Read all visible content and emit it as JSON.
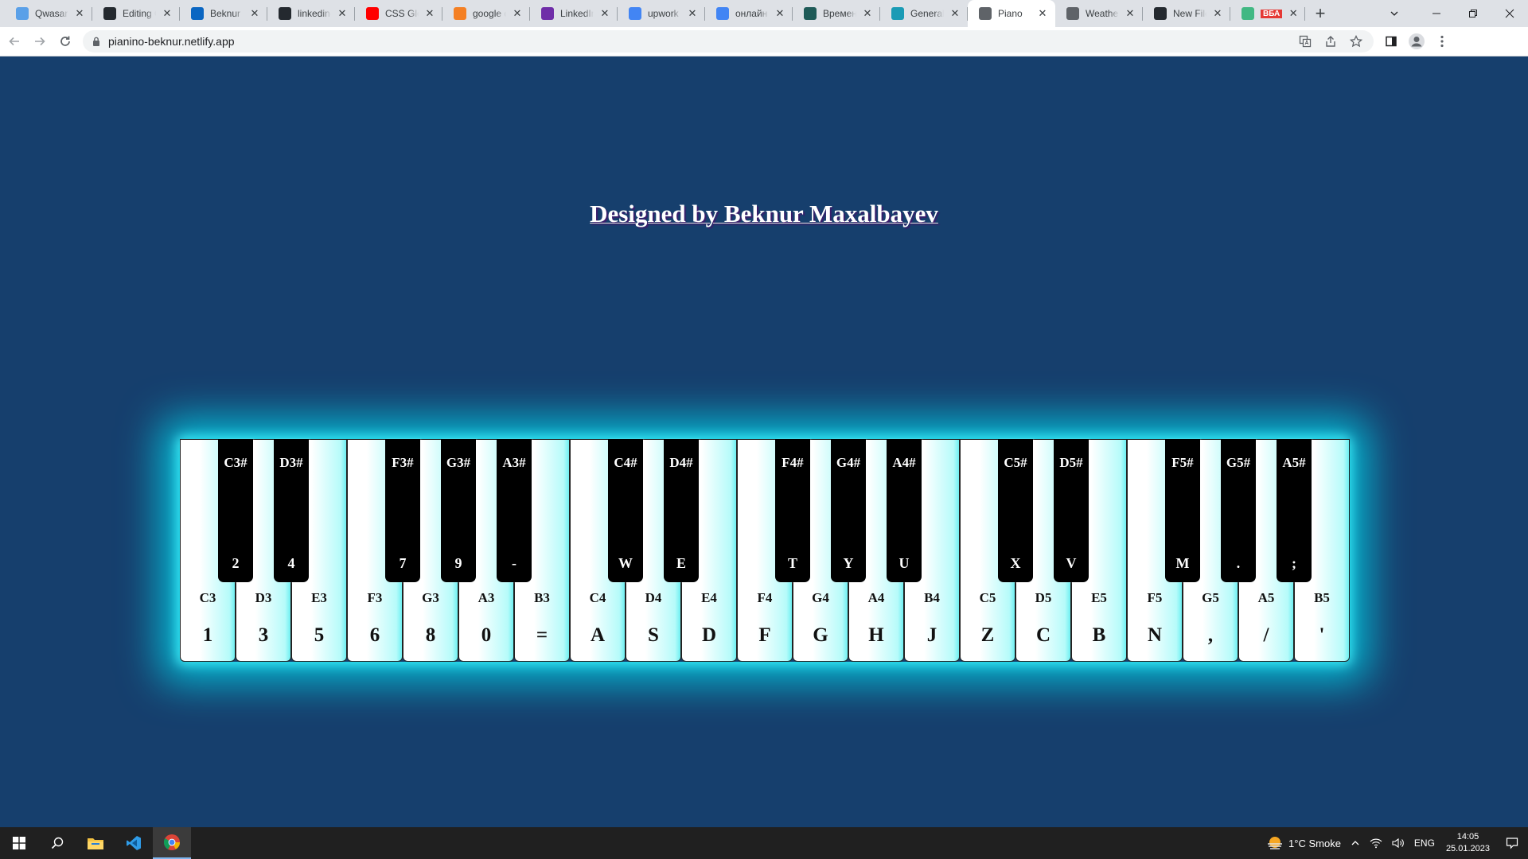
{
  "browser": {
    "tabs": [
      {
        "title": "Qwasar.",
        "favicon": "qwasar-icon",
        "color": "#5aa0e8"
      },
      {
        "title": "Editing C",
        "favicon": "github-icon",
        "color": "#24292f"
      },
      {
        "title": "Beknur M",
        "favicon": "linkedin-icon",
        "color": "#0a66c2"
      },
      {
        "title": "linkedin-",
        "favicon": "github-icon",
        "color": "#24292f"
      },
      {
        "title": "CSS Glow",
        "favicon": "youtube-icon",
        "color": "#ff0000"
      },
      {
        "title": "google c",
        "favicon": "stackoverflow-icon",
        "color": "#f48024"
      },
      {
        "title": "LinkedIn",
        "favicon": "linkedin-learning-icon",
        "color": "#6f2da8"
      },
      {
        "title": "upwork",
        "favicon": "google-icon",
        "color": "#4285f4"
      },
      {
        "title": "онлайн",
        "favicon": "google-icon",
        "color": "#4285f4"
      },
      {
        "title": "Времен",
        "favicon": "chatgpt-icon",
        "color": "#1f5b58"
      },
      {
        "title": "General",
        "favicon": "diamond-icon",
        "color": "#1a9bb5"
      },
      {
        "title": "Piano",
        "favicon": "globe-icon",
        "color": "#5f6368",
        "active": true
      },
      {
        "title": "Weather",
        "favicon": "globe-icon",
        "color": "#5f6368"
      },
      {
        "title": "New File",
        "favicon": "github-icon",
        "color": "#24292f"
      },
      {
        "title": "ВБА",
        "favicon": "vue-icon",
        "color": "#41b883"
      }
    ],
    "new_tab_symbol": "+",
    "url": "pianino-beknur.netlify.app"
  },
  "page": {
    "title": "Designed by Beknur Maxalbayev"
  },
  "piano": {
    "white_keys": [
      {
        "note": "C3",
        "key": "1"
      },
      {
        "note": "D3",
        "key": "3"
      },
      {
        "note": "E3",
        "key": "5"
      },
      {
        "note": "F3",
        "key": "6"
      },
      {
        "note": "G3",
        "key": "8"
      },
      {
        "note": "A3",
        "key": "0"
      },
      {
        "note": "B3",
        "key": "="
      },
      {
        "note": "C4",
        "key": "A"
      },
      {
        "note": "D4",
        "key": "S"
      },
      {
        "note": "E4",
        "key": "D"
      },
      {
        "note": "F4",
        "key": "F"
      },
      {
        "note": "G4",
        "key": "G"
      },
      {
        "note": "A4",
        "key": "H"
      },
      {
        "note": "B4",
        "key": "J"
      },
      {
        "note": "C5",
        "key": "Z"
      },
      {
        "note": "D5",
        "key": "C"
      },
      {
        "note": "E5",
        "key": "B"
      },
      {
        "note": "F5",
        "key": "N"
      },
      {
        "note": "G5",
        "key": ","
      },
      {
        "note": "A5",
        "key": "/"
      },
      {
        "note": "B5",
        "key": "'"
      }
    ],
    "black_keys": [
      {
        "note": "C3#",
        "key": "2",
        "after_white": 0
      },
      {
        "note": "D3#",
        "key": "4",
        "after_white": 1
      },
      {
        "note": "F3#",
        "key": "7",
        "after_white": 3
      },
      {
        "note": "G3#",
        "key": "9",
        "after_white": 4
      },
      {
        "note": "A3#",
        "key": "-",
        "after_white": 5
      },
      {
        "note": "C4#",
        "key": "W",
        "after_white": 7
      },
      {
        "note": "D4#",
        "key": "E",
        "after_white": 8
      },
      {
        "note": "F4#",
        "key": "T",
        "after_white": 10
      },
      {
        "note": "G4#",
        "key": "Y",
        "after_white": 11
      },
      {
        "note": "A4#",
        "key": "U",
        "after_white": 12
      },
      {
        "note": "C5#",
        "key": "X",
        "after_white": 14
      },
      {
        "note": "D5#",
        "key": "V",
        "after_white": 15
      },
      {
        "note": "F5#",
        "key": "M",
        "after_white": 17
      },
      {
        "note": "G5#",
        "key": ".",
        "after_white": 18
      },
      {
        "note": "A5#",
        "key": ";",
        "after_white": 19
      }
    ]
  },
  "taskbar": {
    "weather": "1°C  Smoke",
    "language": "ENG",
    "time": "14:05",
    "date": "25.01.2023"
  }
}
